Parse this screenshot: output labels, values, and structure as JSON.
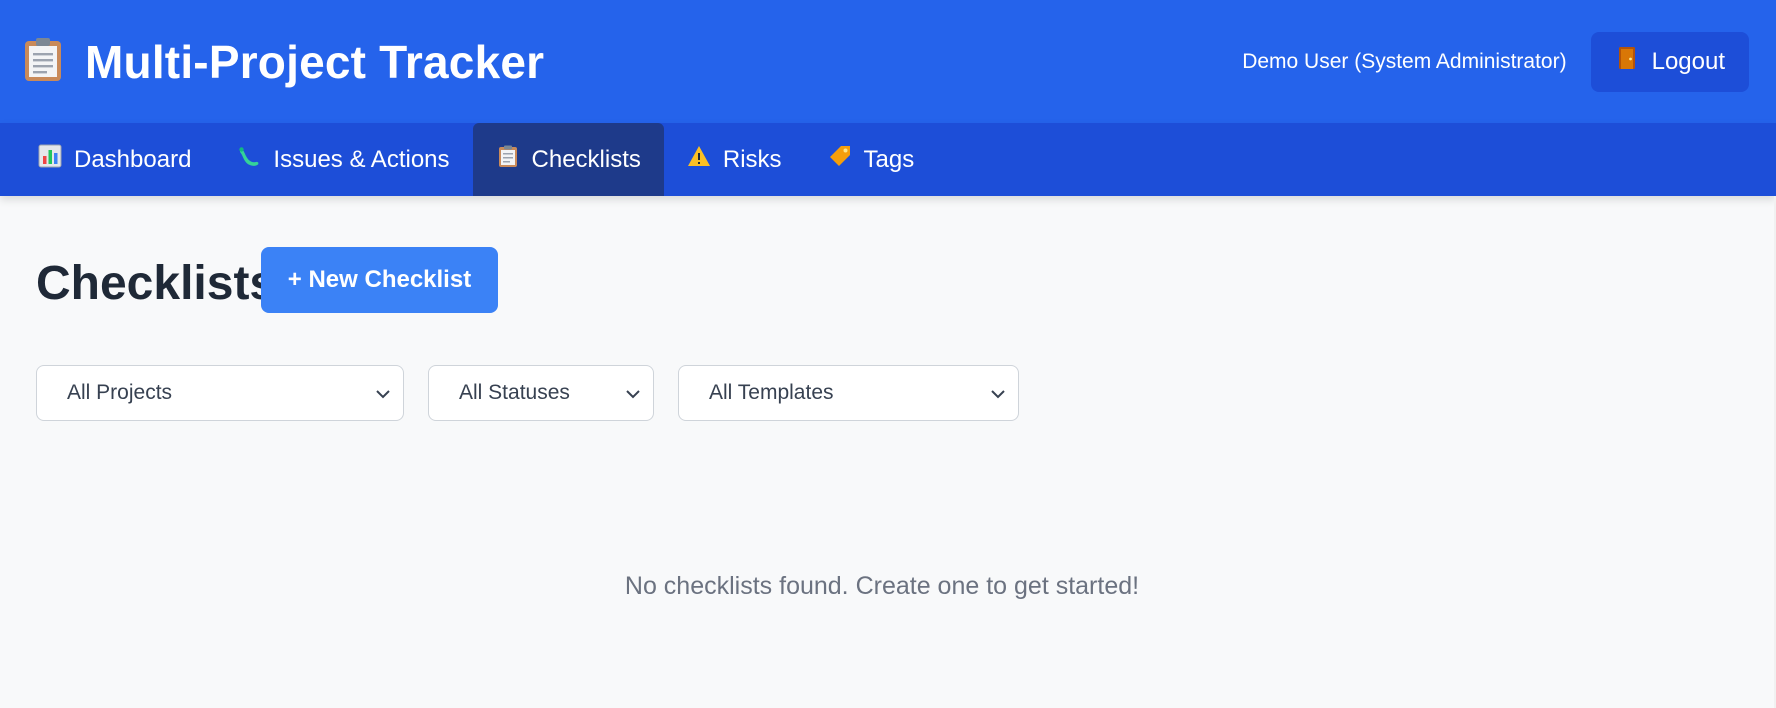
{
  "header": {
    "title": "Multi-Project Tracker",
    "icon": "clipboard-icon",
    "user_label": "Demo User (System Administrator)",
    "logout_label": "Logout",
    "brand_color": "#2563eb",
    "nav_color": "#1d4ed8"
  },
  "nav": {
    "items": [
      {
        "label": "Dashboard",
        "icon": "bar-chart-icon"
      },
      {
        "label": "Issues & Actions",
        "icon": "bug-icon"
      },
      {
        "label": "Checklists",
        "icon": "clipboard-icon",
        "active": true
      },
      {
        "label": "Risks",
        "icon": "warning-icon"
      },
      {
        "label": "Tags",
        "icon": "tag-icon"
      }
    ]
  },
  "main": {
    "title": "Checklists",
    "new_button_label": "+ New Checklist",
    "filters": {
      "project": "All Projects",
      "status": "All Statuses",
      "template": "All Templates"
    },
    "empty_message": "No checklists found. Create one to get started!"
  }
}
